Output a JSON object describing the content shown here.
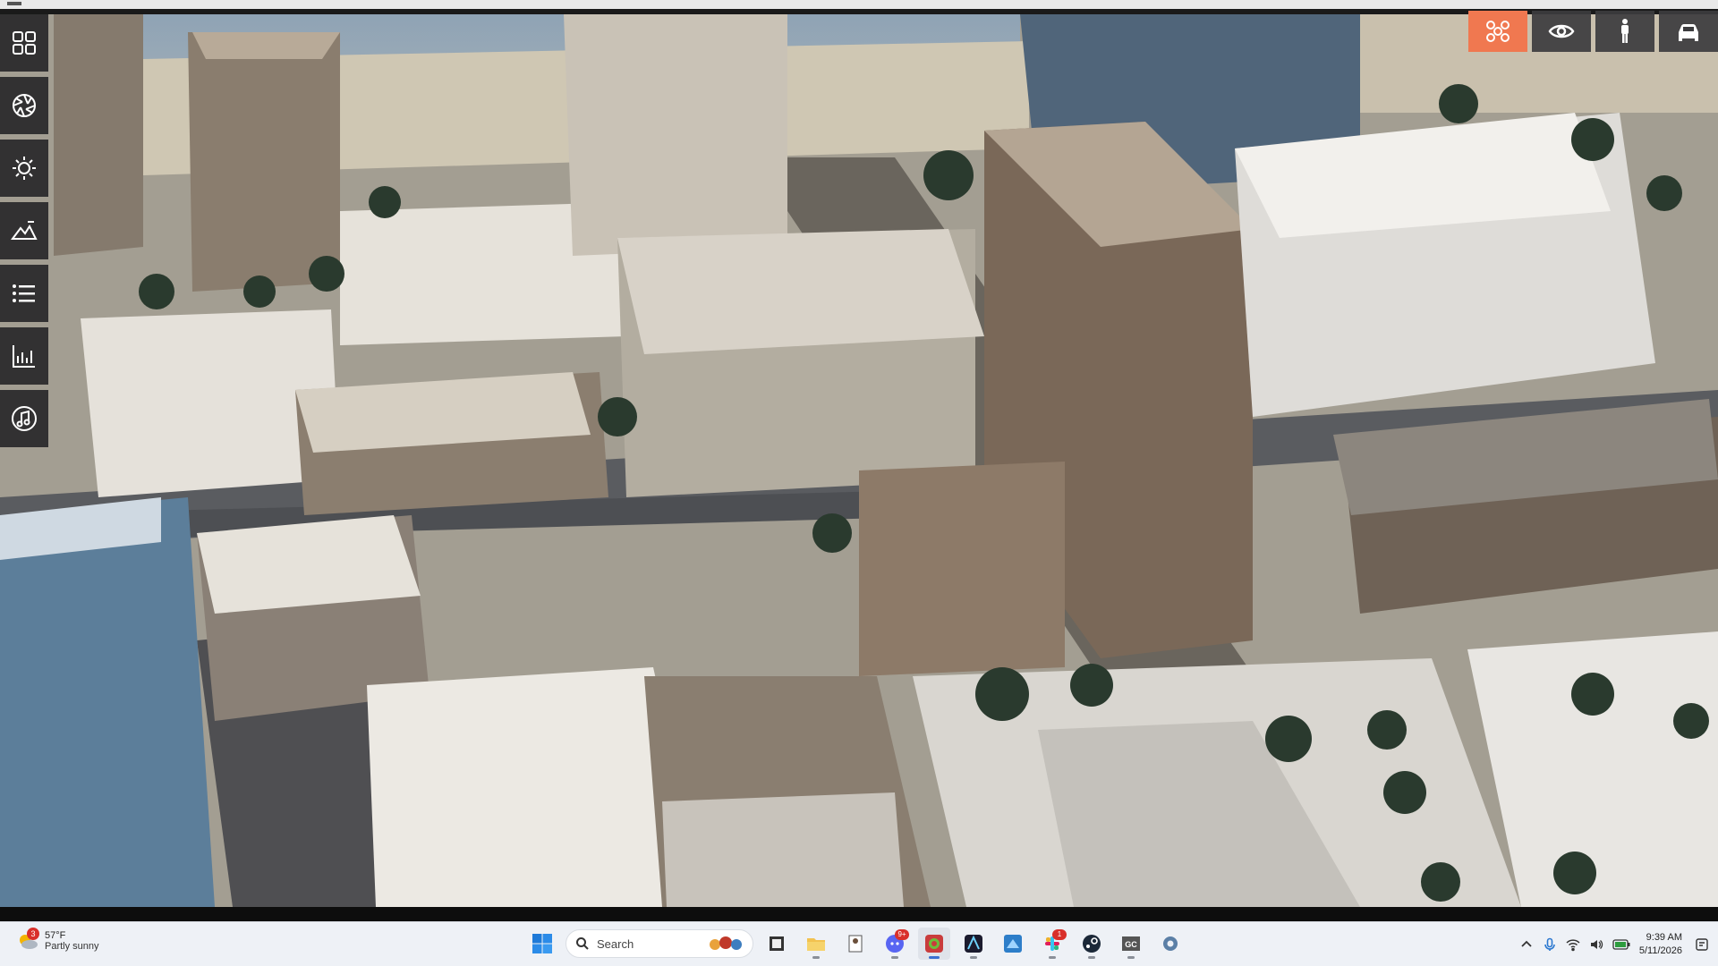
{
  "rail": {
    "items": [
      {
        "name": "grid-icon"
      },
      {
        "name": "aperture-icon"
      },
      {
        "name": "sun-icon"
      },
      {
        "name": "terrain-icon"
      },
      {
        "name": "list-icon"
      },
      {
        "name": "bar-chart-icon"
      },
      {
        "name": "music-icon"
      }
    ]
  },
  "modes": [
    {
      "name": "drone-mode-icon",
      "active": true
    },
    {
      "name": "eye-icon",
      "active": false
    },
    {
      "name": "pedestrian-icon",
      "active": false
    },
    {
      "name": "car-icon",
      "active": false
    }
  ],
  "colors": {
    "accent": "#f07850",
    "rail": "#28282a"
  },
  "taskbar": {
    "weather": {
      "badge": "3",
      "temp": "57°F",
      "condition": "Partly sunny"
    },
    "search": {
      "placeholder": "Search"
    },
    "apps": [
      {
        "name": "file-viewer-icon",
        "badge": ""
      },
      {
        "name": "file-explorer-icon",
        "badge": ""
      },
      {
        "name": "notepad-icon",
        "badge": ""
      },
      {
        "name": "discord-icon",
        "badge": "9+"
      },
      {
        "name": "app-green-icon",
        "badge": ""
      },
      {
        "name": "affinity-icon",
        "badge": ""
      },
      {
        "name": "app-blue-icon",
        "badge": ""
      },
      {
        "name": "slack-icon",
        "badge": "1"
      },
      {
        "name": "steam-icon",
        "badge": ""
      },
      {
        "name": "gc-icon",
        "badge": ""
      },
      {
        "name": "settings-icon",
        "badge": ""
      }
    ],
    "clock": {
      "time": "9:39 AM",
      "date": "5/11/2026"
    }
  }
}
